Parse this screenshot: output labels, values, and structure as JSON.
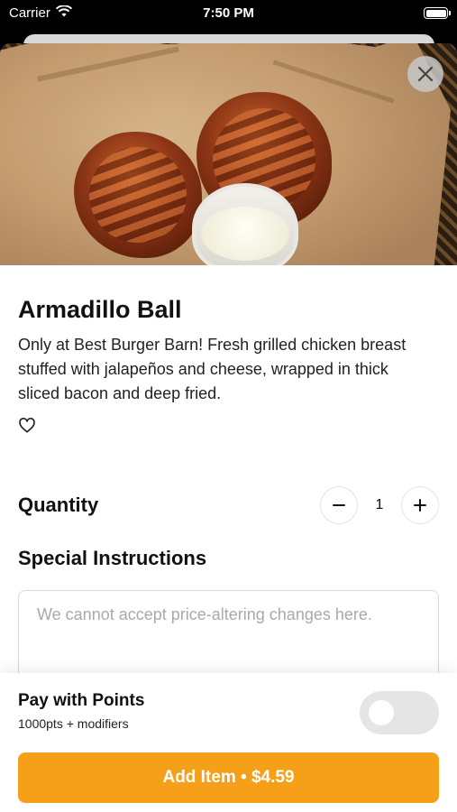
{
  "status_bar": {
    "carrier": "Carrier",
    "time": "7:50 PM"
  },
  "item": {
    "title": "Armadillo Ball",
    "description": "Only at Best Burger Barn! Fresh grilled chicken breast stuffed with jalapeños and cheese, wrapped in thick sliced bacon and deep fried."
  },
  "quantity": {
    "label": "Quantity",
    "value": "1",
    "decrement": "−",
    "increment": "+"
  },
  "special_instructions": {
    "label": "Special Instructions",
    "placeholder": "We cannot accept price-altering changes here.",
    "value": ""
  },
  "points": {
    "title": "Pay with Points",
    "subtitle": "1000pts + modifiers",
    "enabled": false
  },
  "add_button": {
    "label": "Add Item • $4.59"
  },
  "colors": {
    "accent": "#f6a01a",
    "toggle_off": "#e5e5e5"
  }
}
